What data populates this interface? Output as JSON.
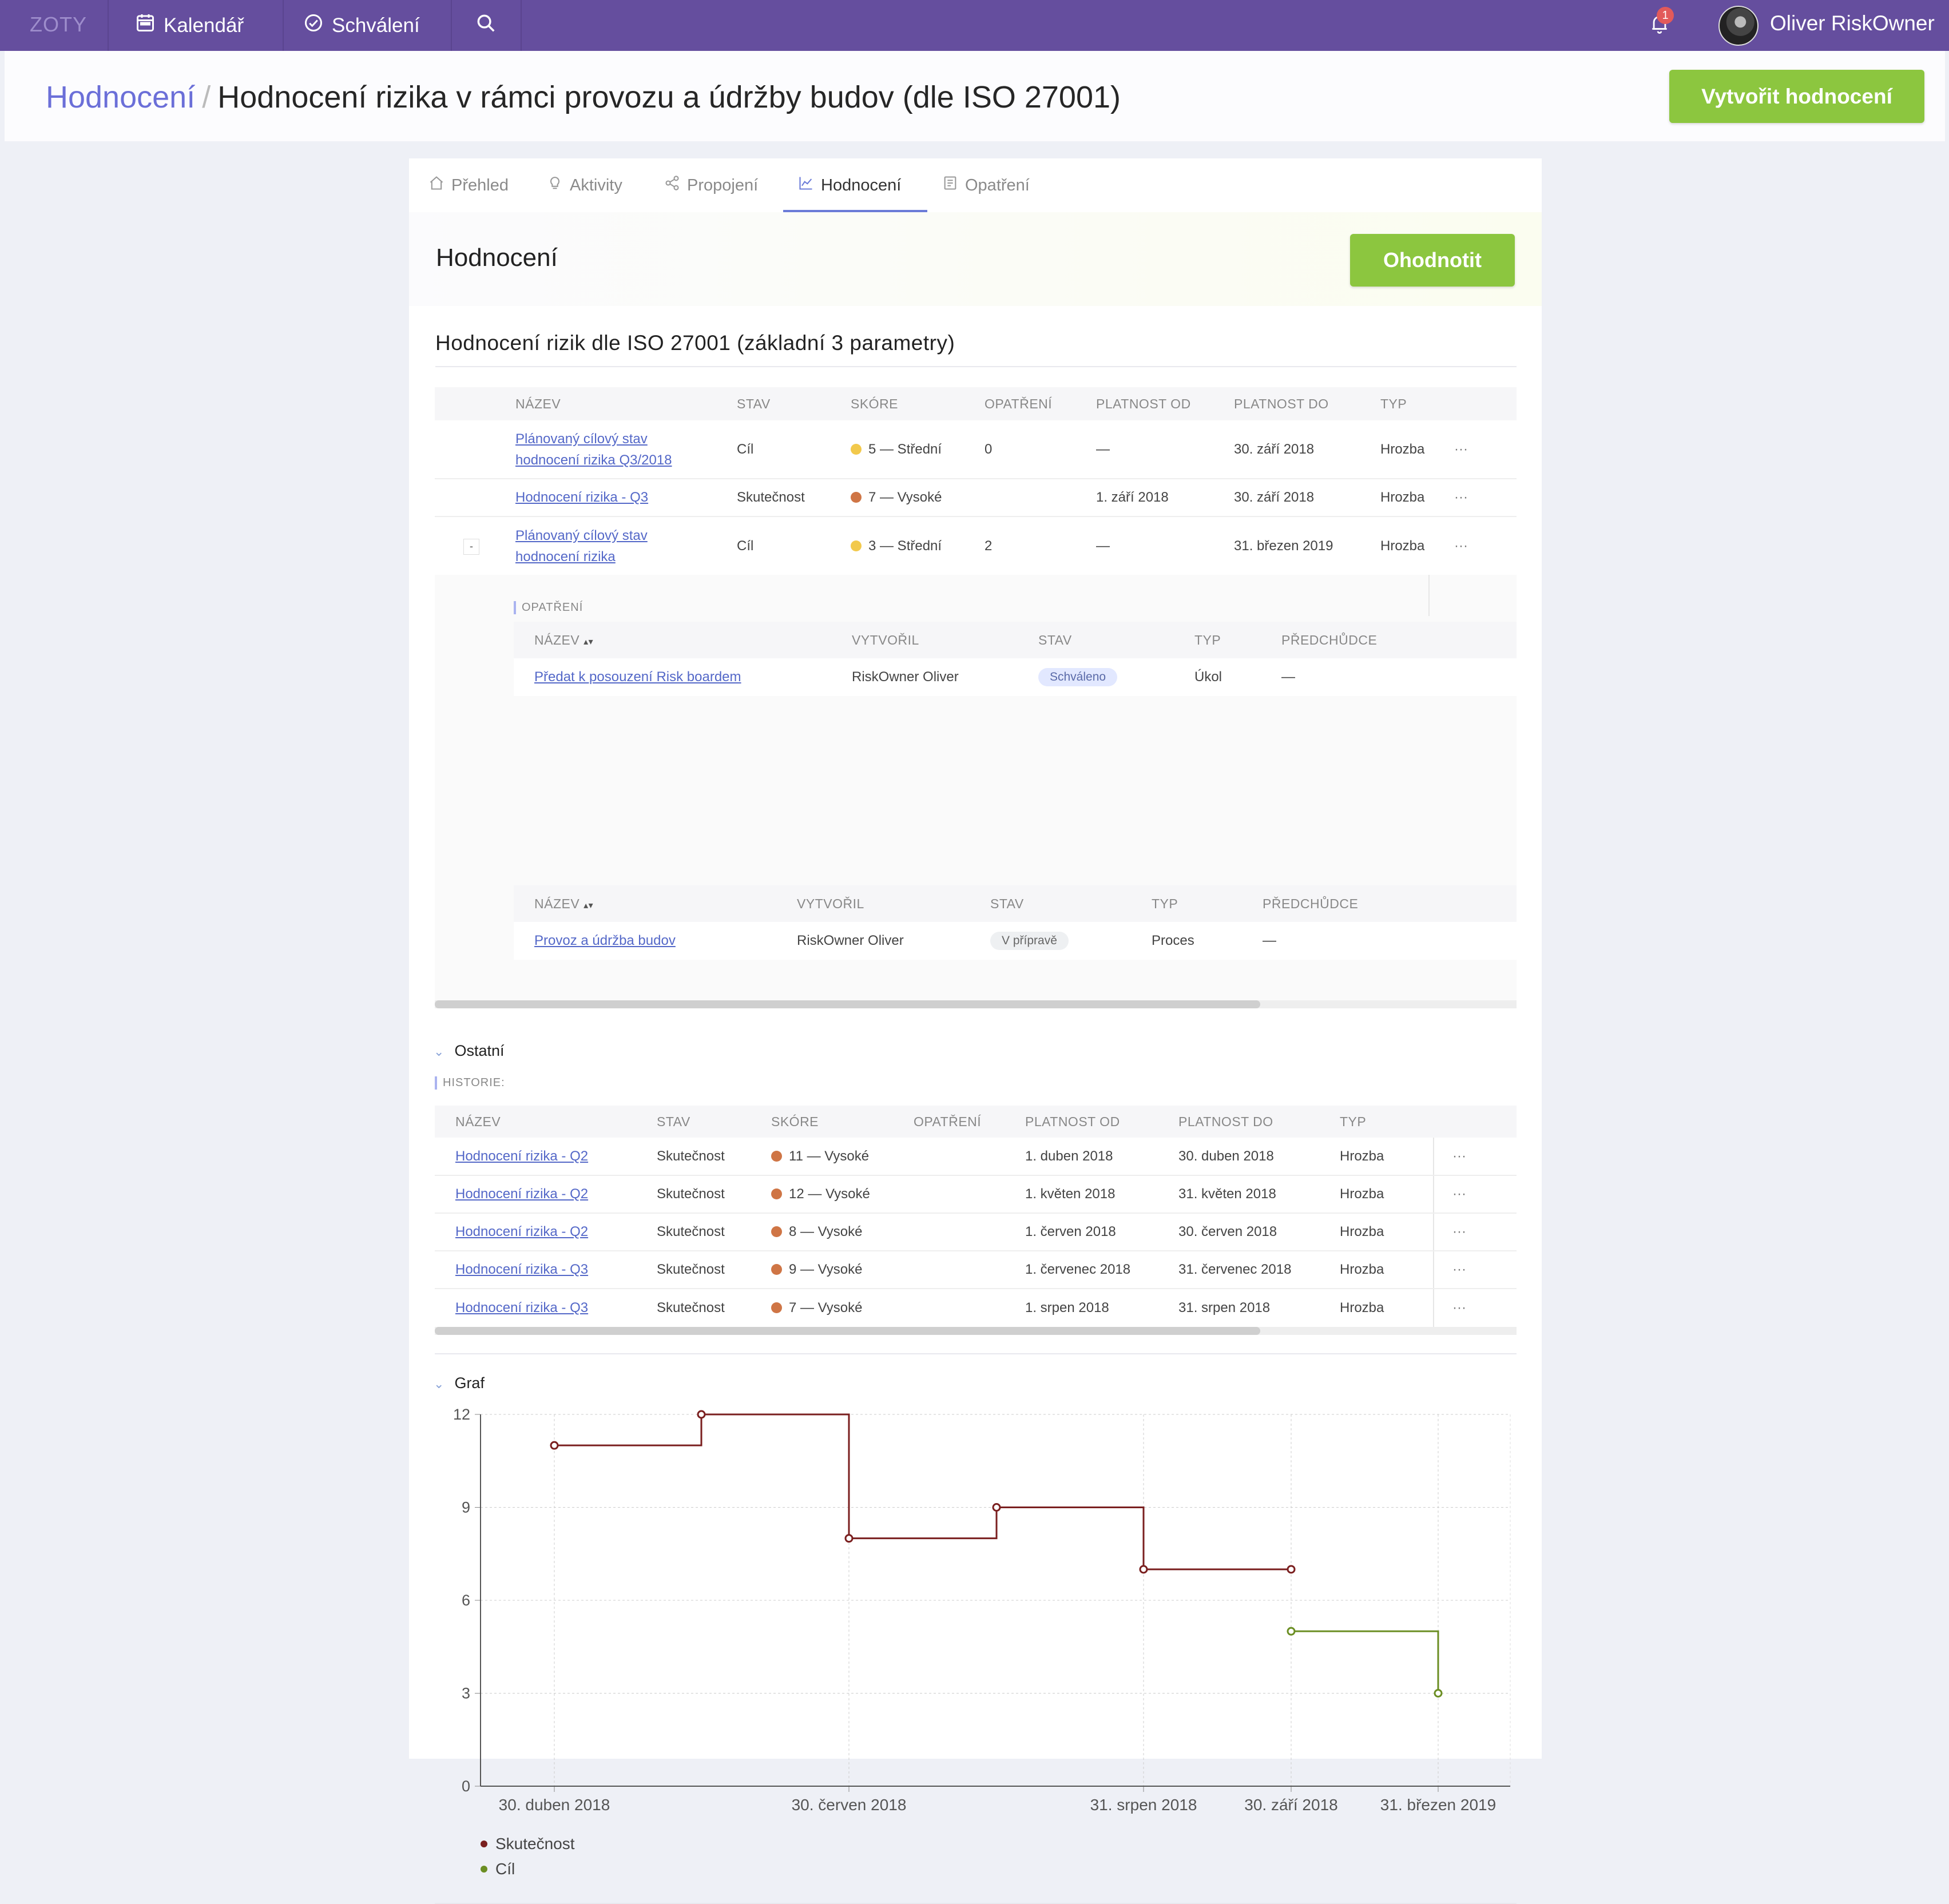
{
  "nav": {
    "brand": "ZOTY",
    "calendar": "Kalendář",
    "approval": "Schválení",
    "notifications_count": "1",
    "user": "Oliver RiskOwner"
  },
  "header": {
    "breadcrumb_root": "Hodnocení",
    "breadcrumb_sep": "/",
    "title": "Hodnocení rizika v rámci provozu a údržby budov (dle ISO 27001)",
    "create_button": "Vytvořit hodnocení"
  },
  "tabs": [
    {
      "label": "Přehled",
      "icon": "home-icon"
    },
    {
      "label": "Aktivity",
      "icon": "bulb-icon"
    },
    {
      "label": "Propojení",
      "icon": "share-icon"
    },
    {
      "label": "Hodnocení",
      "icon": "chart-icon",
      "active": true
    },
    {
      "label": "Opatření",
      "icon": "document-icon"
    }
  ],
  "section": {
    "title": "Hodnocení",
    "rate_button": "Ohodnotit",
    "subtitle": "Hodnocení rizik dle ISO 27001 (základní 3 parametry)"
  },
  "main_table": {
    "headers": [
      "NÁZEV",
      "STAV",
      "SKÓRE",
      "OPATŘENÍ",
      "PLATNOST OD",
      "PLATNOST DO",
      "TYP"
    ],
    "rows": [
      {
        "name_line1": "Plánovaný cílový stav",
        "name_line2": "hodnocení rizika Q3/2018",
        "state": "Cíl",
        "score": "5 — Střední",
        "score_color": "#f2c94c",
        "measures": "0",
        "valid_from": "—",
        "valid_to": "30. září 2018",
        "type": "Hrozba",
        "more": "···"
      },
      {
        "name_line1": "Hodnocení rizika - Q3",
        "name_line2": "",
        "state": "Skutečnost",
        "score": "7 — Vysoké",
        "score_color": "#cf7545",
        "measures": "",
        "valid_from": "1. září 2018",
        "valid_to": "30. září 2018",
        "type": "Hrozba",
        "more": "···"
      },
      {
        "name_line1": "Plánovaný cílový stav",
        "name_line2": "hodnocení rizika",
        "state": "Cíl",
        "score": "3 — Střední",
        "score_color": "#f2c94c",
        "measures": "2",
        "valid_from": "—",
        "valid_to": "31. březen 2019",
        "type": "Hrozba",
        "more": "···",
        "expand": "-"
      }
    ]
  },
  "measures": {
    "label": "OPATŘENÍ",
    "headers": [
      "NÁZEV",
      "VYTVOŘIL",
      "STAV",
      "TYP",
      "PŘEDCHŮDCE"
    ],
    "rows": [
      {
        "name": "Předat k posouzení Risk boardem",
        "created_by": "RiskOwner Oliver",
        "state": "Schváleno",
        "type": "Úkol",
        "predecessor": "—"
      }
    ]
  },
  "processes": {
    "headers": [
      "NÁZEV",
      "VYTVOŘIL",
      "STAV",
      "TYP",
      "PŘEDCHŮDCE"
    ],
    "rows": [
      {
        "name": "Provoz a údržba budov",
        "created_by": "RiskOwner Oliver",
        "state": "V přípravě",
        "type": "Proces",
        "predecessor": "—"
      }
    ]
  },
  "other": {
    "title": "Ostatní",
    "history_label": "HISTORIE:",
    "headers": [
      "NÁZEV",
      "STAV",
      "SKÓRE",
      "OPATŘENÍ",
      "PLATNOST OD",
      "PLATNOST DO",
      "TYP"
    ],
    "rows": [
      {
        "name": "Hodnocení rizika - Q2",
        "state": "Skutečnost",
        "score": "11 — Vysoké",
        "measures": "",
        "valid_from": "1. duben 2018",
        "valid_to": "30. duben 2018",
        "type": "Hrozba",
        "more": "···"
      },
      {
        "name": "Hodnocení rizika - Q2",
        "state": "Skutečnost",
        "score": "12 — Vysoké",
        "measures": "",
        "valid_from": "1. květen 2018",
        "valid_to": "31. květen 2018",
        "type": "Hrozba",
        "more": "···"
      },
      {
        "name": "Hodnocení rizika - Q2",
        "state": "Skutečnost",
        "score": "8 — Vysoké",
        "measures": "",
        "valid_from": "1. červen 2018",
        "valid_to": "30. červen 2018",
        "type": "Hrozba",
        "more": "···"
      },
      {
        "name": "Hodnocení rizika - Q3",
        "state": "Skutečnost",
        "score": "9 — Vysoké",
        "measures": "",
        "valid_from": "1. červenec 2018",
        "valid_to": "31. červenec 2018",
        "type": "Hrozba",
        "more": "···"
      },
      {
        "name": "Hodnocení rizika - Q3",
        "state": "Skutečnost",
        "score": "7 — Vysoké",
        "measures": "",
        "valid_from": "1. srpen 2018",
        "valid_to": "31. srpen 2018",
        "type": "Hrozba",
        "more": "···"
      }
    ]
  },
  "graph_section": {
    "title": "Graf"
  },
  "colors": {
    "accent": "#654e9e",
    "green": "#8cc63f",
    "actual": "#7a1f1f",
    "target": "#6b8e23"
  },
  "chart_data": {
    "type": "line",
    "title": "",
    "xlabel": "",
    "ylabel": "",
    "ylim": [
      0,
      12
    ],
    "yticks": [
      0,
      3,
      6,
      9,
      12
    ],
    "x_ticks": [
      "30. duben 2018",
      "30. červen 2018",
      "31. srpen 2018",
      "30. září 2018",
      "31. březen 2019"
    ],
    "x_points": [
      "30. duben 2018",
      "31. květen 2018",
      "30. červen 2018",
      "31. červenec 2018",
      "31. srpen 2018",
      "30. září 2018",
      "31. březen 2019"
    ],
    "step": true,
    "grid": true,
    "legend_position": "bottom-left",
    "series": [
      {
        "name": "Skutečnost",
        "color": "#7a1f1f",
        "points": [
          [
            "30. duben 2018",
            11
          ],
          [
            "31. květen 2018",
            12
          ],
          [
            "30. červen 2018",
            8
          ],
          [
            "31. červenec 2018",
            9
          ],
          [
            "31. srpen 2018",
            7
          ],
          [
            "30. září 2018",
            7
          ]
        ]
      },
      {
        "name": "Cíl",
        "color": "#6b8e23",
        "points": [
          [
            "30. září 2018",
            5
          ],
          [
            "31. březen 2019",
            3
          ]
        ]
      }
    ]
  }
}
